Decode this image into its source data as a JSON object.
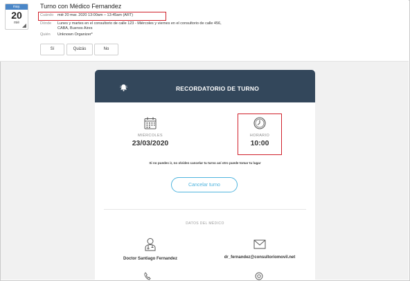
{
  "invite": {
    "month": "may.",
    "day": "20",
    "weekday": "mié",
    "title": "Turno con Médico Fernandez",
    "when_label": "Cuándo",
    "when_value": "mié 20 mar. 2020 13:00am – 13:45am (ART)",
    "where_label": "Dónde",
    "where_line1": "Lunes y martes en el consultorio de calle 123 - Miércoles y viernes en el consultorio de calle 456,",
    "where_line2": "CABA, Buenos Aires",
    "who_label": "Quién",
    "who_value": "Unknown Organizer*",
    "rsvp": {
      "yes": "Sí",
      "maybe": "Quizás",
      "no": "No"
    }
  },
  "card": {
    "header_title": "RECORDATORIO DE TURNO",
    "date_label": "MIÉRCOLES",
    "date_value": "23/03/2020",
    "time_label": "HORARIO",
    "time_value": "10:00",
    "note": "Si no puedes ir, no olvides cancelar tu turno así otro puede tomar tu lugar",
    "cancel_button": "Cancelar turno",
    "section_title": "DATOS DEL MÉDICO",
    "doctor_name": "Doctor Santiago Fernandez",
    "doctor_email": "dr_fernandez@consultoriomovil.net"
  },
  "colors": {
    "header_bg": "#33475b",
    "accent": "#4fb4de",
    "highlight": "#d0202a",
    "chip_blue": "#4a86c7"
  },
  "icons": [
    "calendar-icon",
    "clock-icon",
    "bell-icon",
    "doctor-icon",
    "mail-icon",
    "phone-icon",
    "location-icon"
  ]
}
